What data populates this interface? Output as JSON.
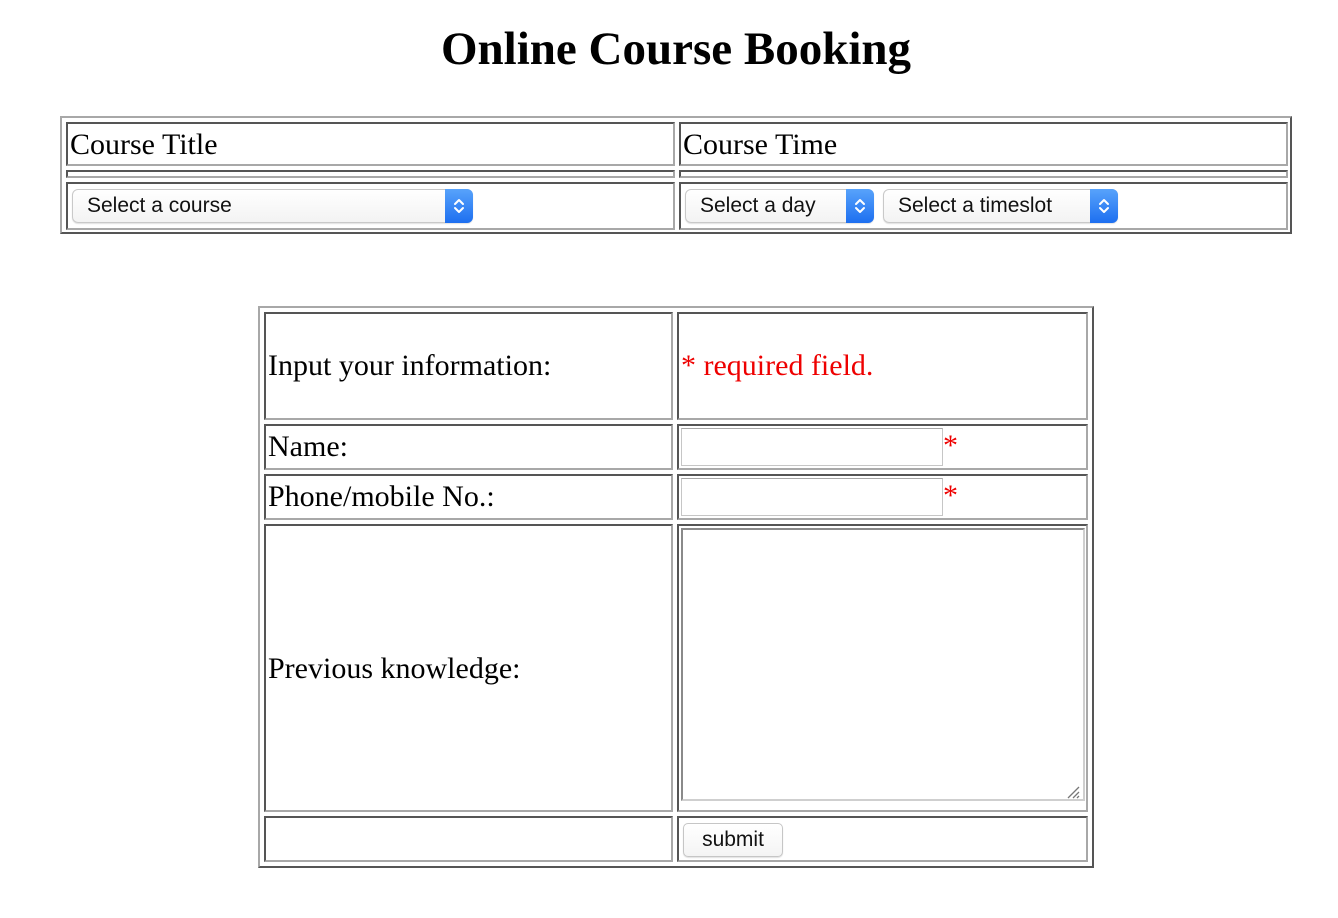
{
  "page": {
    "title": "Online Course Booking"
  },
  "course_table": {
    "headers": [
      "Course Title",
      "Course Time"
    ],
    "course_select": {
      "selected": "Select a course"
    },
    "day_select": {
      "selected": "Select a day"
    },
    "timeslot_select": {
      "selected": "Select a timeslot"
    }
  },
  "info_form": {
    "intro_label": "Input your information:",
    "required_note": "* required field.",
    "name_label": "Name:",
    "name_value": "",
    "phone_label": "Phone/mobile No.:",
    "phone_value": "",
    "required_mark": "*",
    "knowledge_label": "Previous knowledge:",
    "knowledge_value": "",
    "submit_label": "submit"
  },
  "colors": {
    "required": "#ee0000",
    "select_arrow": "#1d6ff0"
  },
  "icons": {
    "select_arrow": "chevron-updown-icon",
    "textarea_resize": "resize-grip-icon"
  }
}
